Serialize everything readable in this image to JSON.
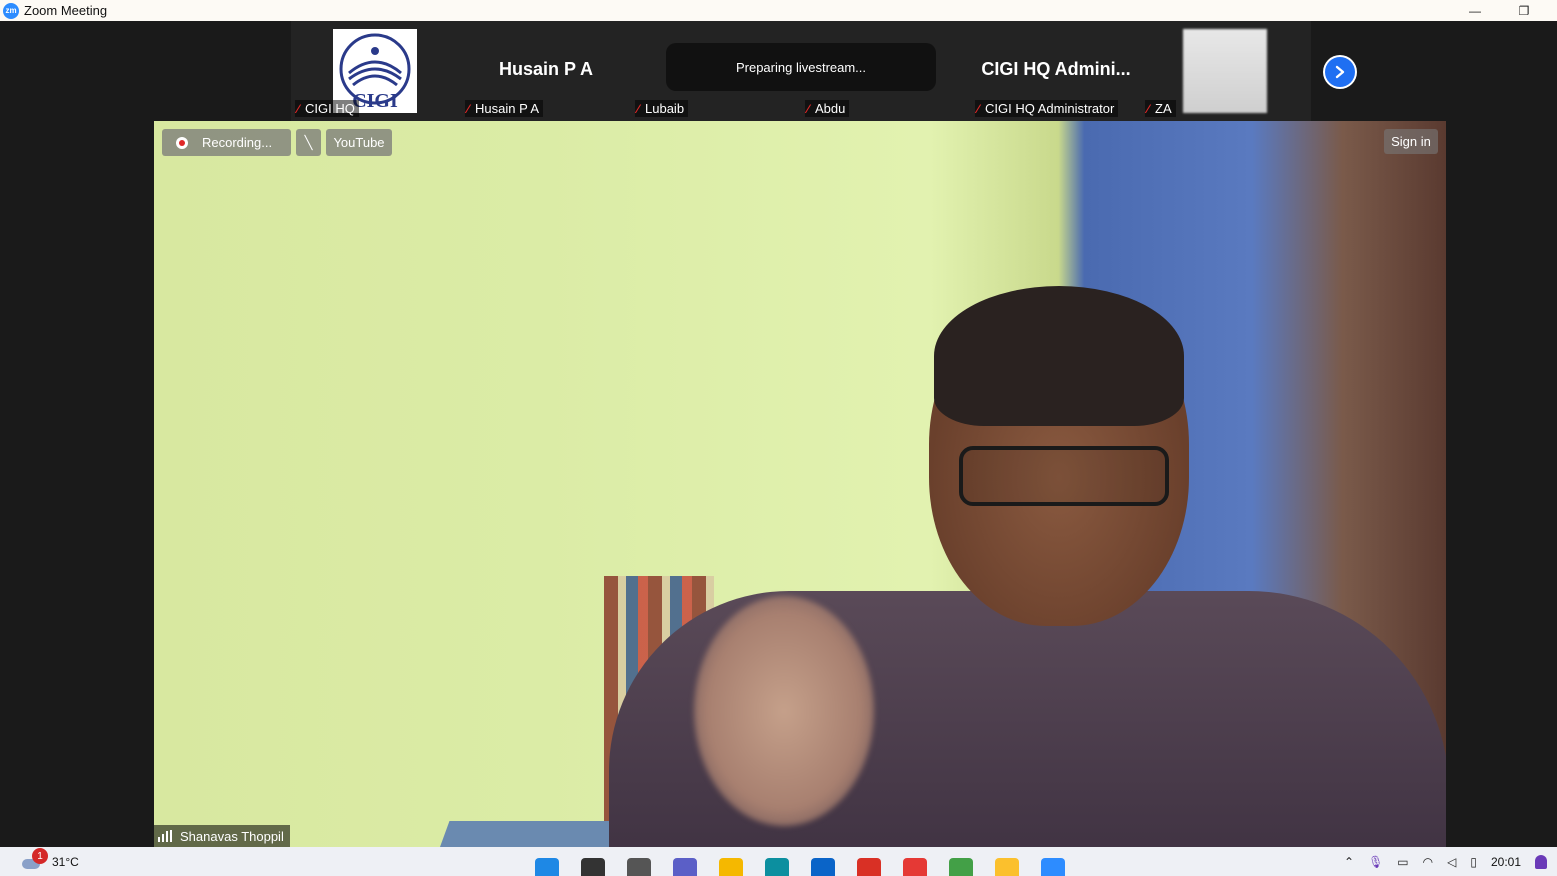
{
  "window": {
    "app_logo": "zm",
    "title": "Zoom Meeting",
    "minimize_icon": "—",
    "restore_icon": "❐"
  },
  "gallery": {
    "tiles": [
      {
        "name": "",
        "label": "CIGI HQ",
        "has_logo": true,
        "logo_text": "CIGI"
      },
      {
        "name": "Husain P A",
        "label": "Husain P A"
      },
      {
        "name": "Lubaib",
        "label": "Lubaib"
      },
      {
        "name": "Abdu",
        "label": "Abdu"
      },
      {
        "name": "CIGI HQ Admini...",
        "label": "CIGI HQ Administrator"
      },
      {
        "name": "",
        "label": "ZA",
        "blurred": true
      }
    ],
    "toast": "Preparing livestream...",
    "next_icon": "chevron-right-icon"
  },
  "main_video": {
    "recording_label": "Recording...",
    "youtube_label": "YouTube",
    "sign_in_label": "Sign in",
    "speaker_name": "Shanavas Thoppil"
  },
  "taskbar": {
    "weather_badge": "1",
    "temperature": "31°C",
    "clock_time": "20:01",
    "apps": [
      {
        "name": "windows-start",
        "color": "#1e88e5"
      },
      {
        "name": "search",
        "color": "#333333"
      },
      {
        "name": "task-view",
        "color": "#555555"
      },
      {
        "name": "teams",
        "color": "#5b5fc7"
      },
      {
        "name": "file-explorer",
        "color": "#f5b800"
      },
      {
        "name": "edge",
        "color": "#0c8f9f"
      },
      {
        "name": "mail",
        "color": "#0a64c8"
      },
      {
        "name": "gmail",
        "color": "#d93025"
      },
      {
        "name": "chrome-1",
        "color": "#e53935"
      },
      {
        "name": "chrome-2",
        "color": "#43a047"
      },
      {
        "name": "chrome-3",
        "color": "#fbc02d"
      },
      {
        "name": "zoom",
        "color": "#2d8cff"
      }
    ]
  }
}
